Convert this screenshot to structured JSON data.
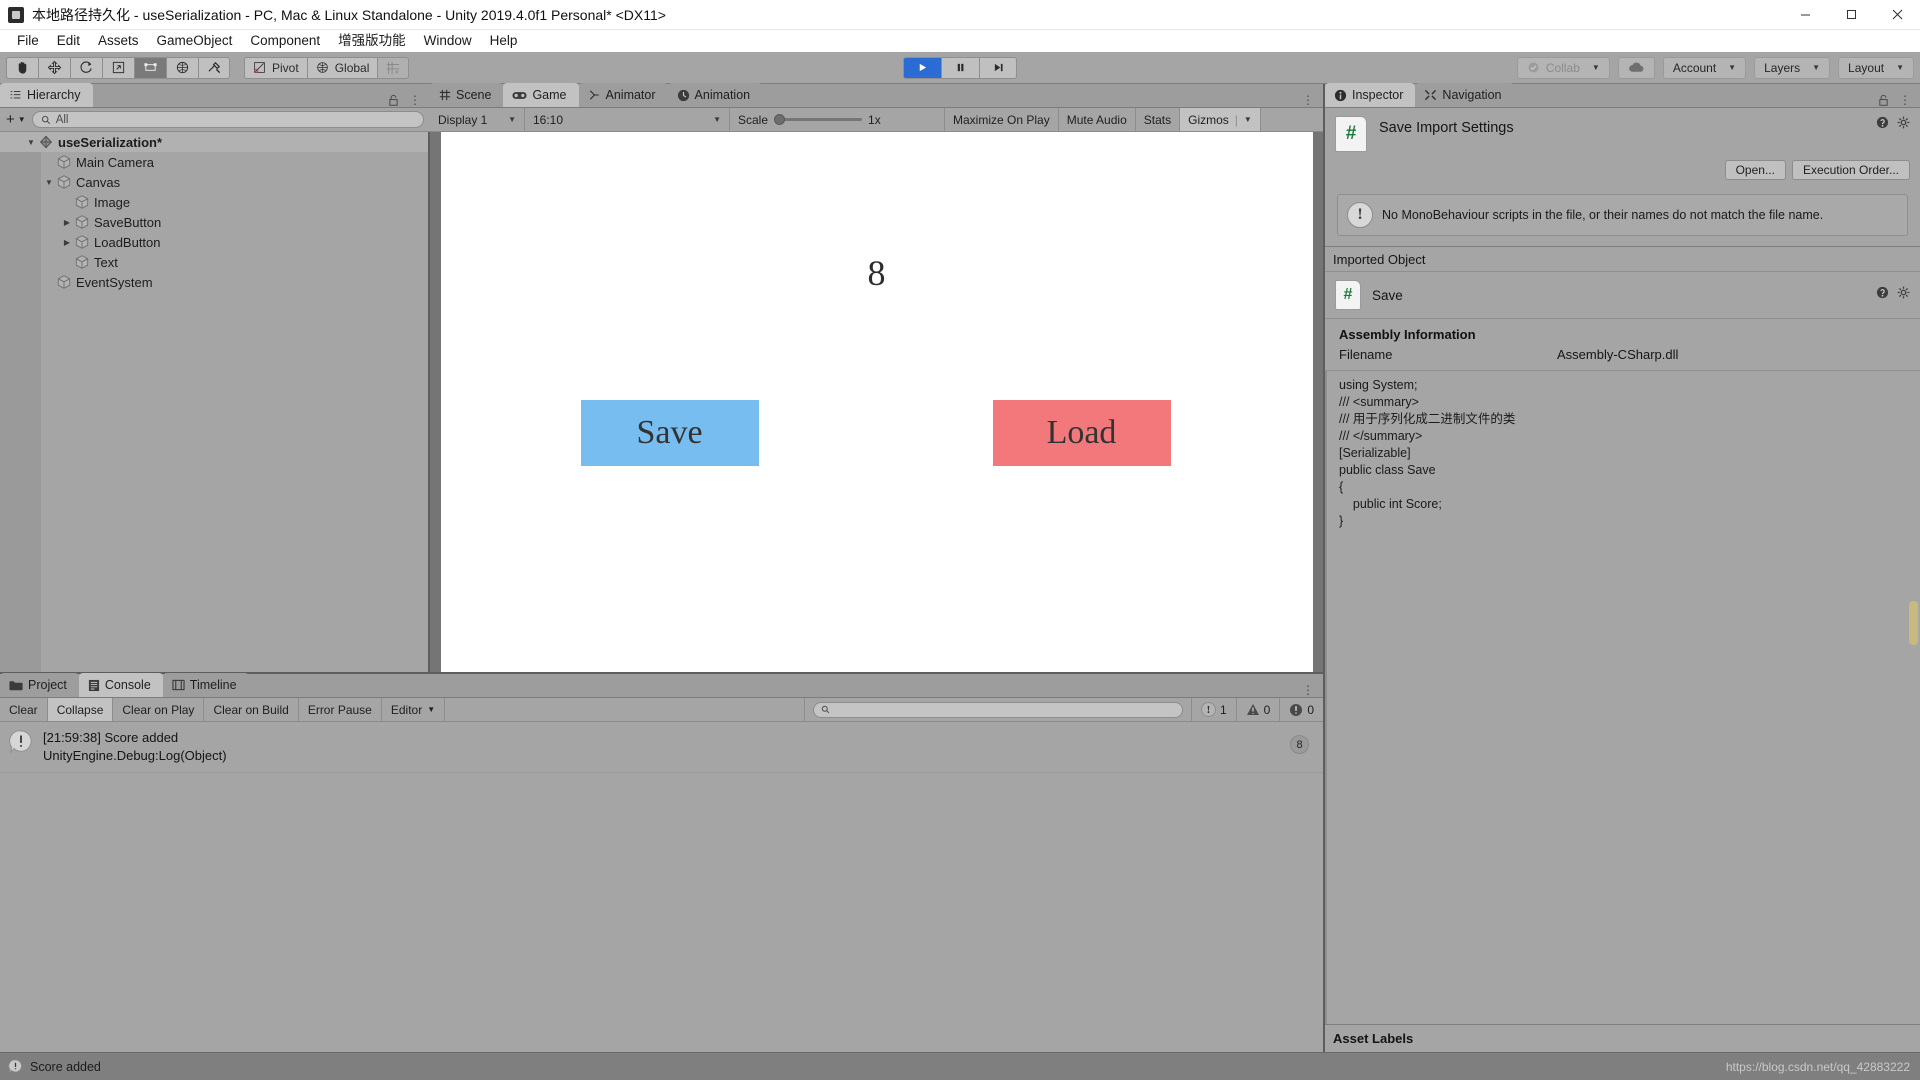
{
  "window": {
    "title": "本地路径持久化 - useSerialization - PC, Mac & Linux Standalone - Unity 2019.4.0f1 Personal* <DX11>",
    "app_icon": "unity-icon",
    "minimize": "–",
    "maximize": "▢",
    "close": "✕"
  },
  "menubar": {
    "items": [
      "File",
      "Edit",
      "Assets",
      "GameObject",
      "Component",
      "增强版功能",
      "Window",
      "Help"
    ]
  },
  "toolbar": {
    "transform_tools": [
      "hand-tool",
      "move-tool",
      "rotate-tool",
      "scale-tool",
      "rect-tool",
      "transform-tool",
      "custom-tool"
    ],
    "pivot_label": "Pivot",
    "global_label": "Global",
    "grid_label": "grid-snap",
    "play": "▶",
    "pause": "❚❚",
    "step": "▶❙",
    "collab_label": "Collab",
    "cloud_label": "cloud-icon",
    "account_label": "Account",
    "layers_label": "Layers",
    "layout_label": "Layout"
  },
  "hierarchy": {
    "tab_label": "Hierarchy",
    "search_placeholder": "All",
    "create_label": "+",
    "items": [
      {
        "label": "useSerialization*",
        "depth": 0,
        "twisty": "▼",
        "selected": true,
        "icon": "unity-scene-icon"
      },
      {
        "label": "Main Camera",
        "depth": 1,
        "twisty": "",
        "selected": false,
        "icon": "gameobject-icon"
      },
      {
        "label": "Canvas",
        "depth": 1,
        "twisty": "▼",
        "selected": false,
        "icon": "gameobject-icon"
      },
      {
        "label": "Image",
        "depth": 2,
        "twisty": "",
        "selected": false,
        "icon": "gameobject-icon"
      },
      {
        "label": "SaveButton",
        "depth": 2,
        "twisty": "▶",
        "selected": false,
        "icon": "gameobject-icon"
      },
      {
        "label": "LoadButton",
        "depth": 2,
        "twisty": "▶",
        "selected": false,
        "icon": "gameobject-icon"
      },
      {
        "label": "Text",
        "depth": 2,
        "twisty": "",
        "selected": false,
        "icon": "gameobject-icon"
      },
      {
        "label": "EventSystem",
        "depth": 1,
        "twisty": "",
        "selected": false,
        "icon": "gameobject-icon"
      }
    ]
  },
  "center": {
    "tabs": [
      {
        "label": "Scene",
        "icon": "scene-icon",
        "active": false
      },
      {
        "label": "Game",
        "icon": "game-icon",
        "active": true
      },
      {
        "label": "Animator",
        "icon": "animator-icon",
        "active": false
      },
      {
        "label": "Animation",
        "icon": "animation-icon",
        "active": false
      }
    ],
    "game_toolbar": {
      "display": "Display 1",
      "aspect": "16:10",
      "scale_label": "Scale",
      "scale_value": "1x",
      "maximize_on_play": "Maximize On Play",
      "mute_audio": "Mute Audio",
      "stats": "Stats",
      "gizmos": "Gizmos"
    },
    "game_content": {
      "score": "8",
      "save_button": "Save",
      "load_button": "Load",
      "save_color": "#77bdf0",
      "load_color": "#f2787c"
    }
  },
  "inspector": {
    "tabs": [
      {
        "label": "Inspector",
        "icon": "info-icon",
        "active": true
      },
      {
        "label": "Navigation",
        "icon": "navigation-icon",
        "active": false
      }
    ],
    "title": "Save Import Settings",
    "open_button": "Open...",
    "execution_order_button": "Execution Order...",
    "help_message": "No MonoBehaviour scripts in the file, or their names do not match the file name.",
    "imported_object_header": "Imported Object",
    "imported_object_name": "Save",
    "assembly_title": "Assembly Information",
    "filename_key": "Filename",
    "filename_value": "Assembly-CSharp.dll",
    "code_lines": [
      "using System;",
      "/// <summary>",
      "/// 用于序列化成二进制文件的类",
      "/// </summary>",
      "[Serializable]",
      "public class Save",
      "{",
      "    public int Score;",
      "}"
    ],
    "asset_labels": "Asset Labels"
  },
  "console": {
    "tabs": [
      {
        "label": "Project",
        "icon": "folder-icon",
        "active": false
      },
      {
        "label": "Console",
        "icon": "console-icon",
        "active": true
      },
      {
        "label": "Timeline",
        "icon": "timeline-icon",
        "active": false
      }
    ],
    "buttons": [
      "Clear",
      "Collapse",
      "Clear on Play",
      "Clear on Build",
      "Error Pause"
    ],
    "editor_dropdown": "Editor",
    "search_placeholder": "",
    "counts": {
      "info": "1",
      "warning": "0",
      "error": "0"
    },
    "entries": [
      {
        "line1": "[21:59:38] Score added",
        "line2": "UnityEngine.Debug:Log(Object)",
        "badge": "8",
        "icon": "info-bubble-icon"
      }
    ]
  },
  "statusbar": {
    "message": "Score added",
    "watermark": "https://blog.csdn.net/qq_42883222",
    "icon": "info-bubble-icon"
  }
}
